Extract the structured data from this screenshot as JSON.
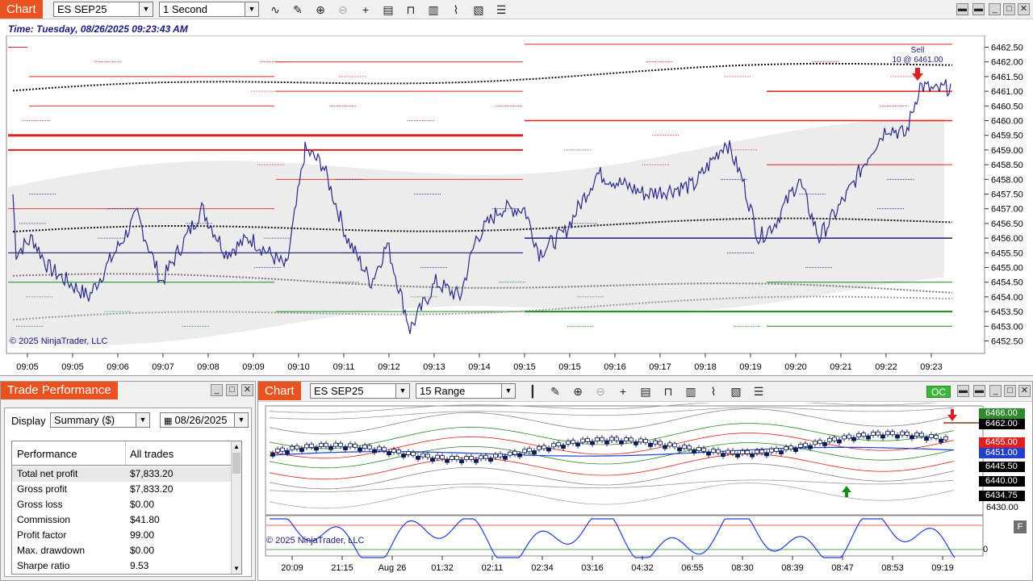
{
  "main": {
    "tab_title": "Chart",
    "instrument": "ES SEP25",
    "interval": "1 Second",
    "time_label": "Time: Tuesday, 08/26/2025 09:23:43 AM",
    "copyright": "© 2025 NinjaTrader, LLC",
    "sell_label": "Sell",
    "sell_qty": "10 @ 6461.00",
    "price_ticks": [
      "6462.50",
      "6462.00",
      "6461.50",
      "6461.00",
      "6460.50",
      "6460.00",
      "6459.50",
      "6459.00",
      "6458.50",
      "6458.00",
      "6457.50",
      "6457.00",
      "6456.50",
      "6456.00",
      "6455.50",
      "6455.00",
      "6454.50",
      "6454.00",
      "6453.50",
      "6453.00",
      "6452.50"
    ],
    "time_ticks": [
      "09:05",
      "09:05",
      "09:06",
      "09:07",
      "09:08",
      "09:09",
      "09:10",
      "09:11",
      "09:12",
      "09:13",
      "09:14",
      "09:15",
      "09:15",
      "09:16",
      "09:17",
      "09:18",
      "09:19",
      "09:20",
      "09:21",
      "09:22",
      "09:23"
    ]
  },
  "perf": {
    "tab_title": "Trade Performance",
    "display_label": "Display",
    "display_value": "Summary ($)",
    "date_value": "08/26/2025",
    "col_performance": "Performance",
    "col_all_trades": "All trades",
    "rows": [
      {
        "label": "Total net profit",
        "value": "$7,833.20"
      },
      {
        "label": "Gross profit",
        "value": "$7,833.20"
      },
      {
        "label": "Gross loss",
        "value": "$0.00"
      },
      {
        "label": "Commission",
        "value": "$41.80"
      },
      {
        "label": "Profit factor",
        "value": "99.00"
      },
      {
        "label": "Max. drawdown",
        "value": "$0.00"
      },
      {
        "label": "Sharpe ratio",
        "value": "9.53"
      }
    ]
  },
  "chart2": {
    "tab_title": "Chart",
    "instrument": "ES SEP25",
    "interval": "15 Range",
    "oc_label": "OC",
    "copyright": "© 2025 NinjaTrader, LLC",
    "f_label": "F",
    "price_tags": [
      {
        "text": "6466.00",
        "color": "#2e8b2e"
      },
      {
        "text": "6462.00",
        "color": "#000000"
      },
      {
        "text": "6455.00",
        "color": "#e02020"
      },
      {
        "text": "6451.00",
        "color": "#2040d0"
      },
      {
        "text": "6445.50",
        "color": "#000000"
      },
      {
        "text": "6440.00",
        "color": "#000000"
      },
      {
        "text": "6434.75",
        "color": "#000000"
      }
    ],
    "axis_6430": "6430.00",
    "osc_zero": "0",
    "time_ticks": [
      "20:09",
      "21:15",
      "Aug 26",
      "01:32",
      "02:11",
      "02:34",
      "03:16",
      "04:32",
      "06:55",
      "08:30",
      "08:39",
      "08:47",
      "08:53",
      "09:19"
    ]
  },
  "colors": {
    "tab_orange": "#e8531f",
    "price_line": "#2a2a8a",
    "resistance": "#e02020",
    "support": "#1a8a1a"
  }
}
